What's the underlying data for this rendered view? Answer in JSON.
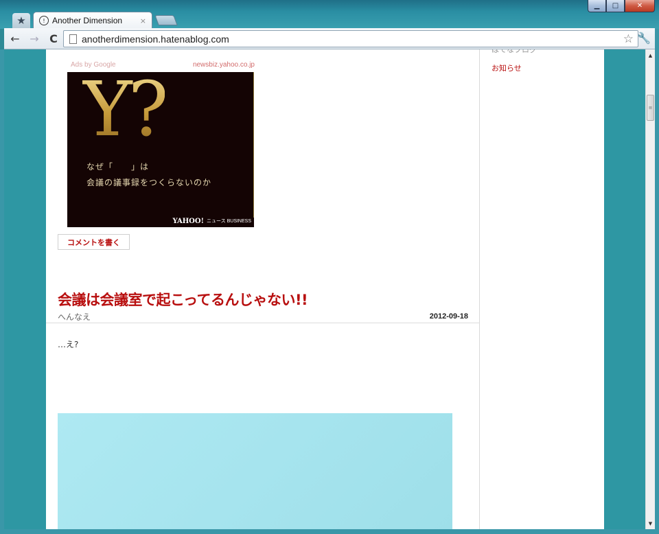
{
  "window": {
    "minimize": "▁",
    "maximize": "□",
    "close": "✕"
  },
  "tab": {
    "title": "Another Dimension",
    "favicon": "!",
    "close": "×"
  },
  "toolbar": {
    "back": "←",
    "forward": "→",
    "reload": "C",
    "url": "anotherdimension.hatenablog.com",
    "bookmark_star": "☆",
    "wrench": "🔧"
  },
  "ad": {
    "ads_by": "Ads by Google",
    "domain": "newsbiz.yahoo.co.jp",
    "big_text": "Y?",
    "line1": "なぜ「　　」は",
    "line2": "会議の議事録をつくらないのか",
    "yahoo": "YAHOO!",
    "biz": "ニュース BUSINESS"
  },
  "comment_button": "コメントを書く",
  "post": {
    "title": "会議は会議室で起こってるんじゃない!!",
    "author": "へんなえ",
    "date": "2012-09-18",
    "body": "…え?"
  },
  "sidebar": {
    "cut_text": "はてなブログ",
    "link": "お知らせ"
  },
  "scrollbar": {
    "up": "▲",
    "down": "▼",
    "grip": "≡"
  }
}
